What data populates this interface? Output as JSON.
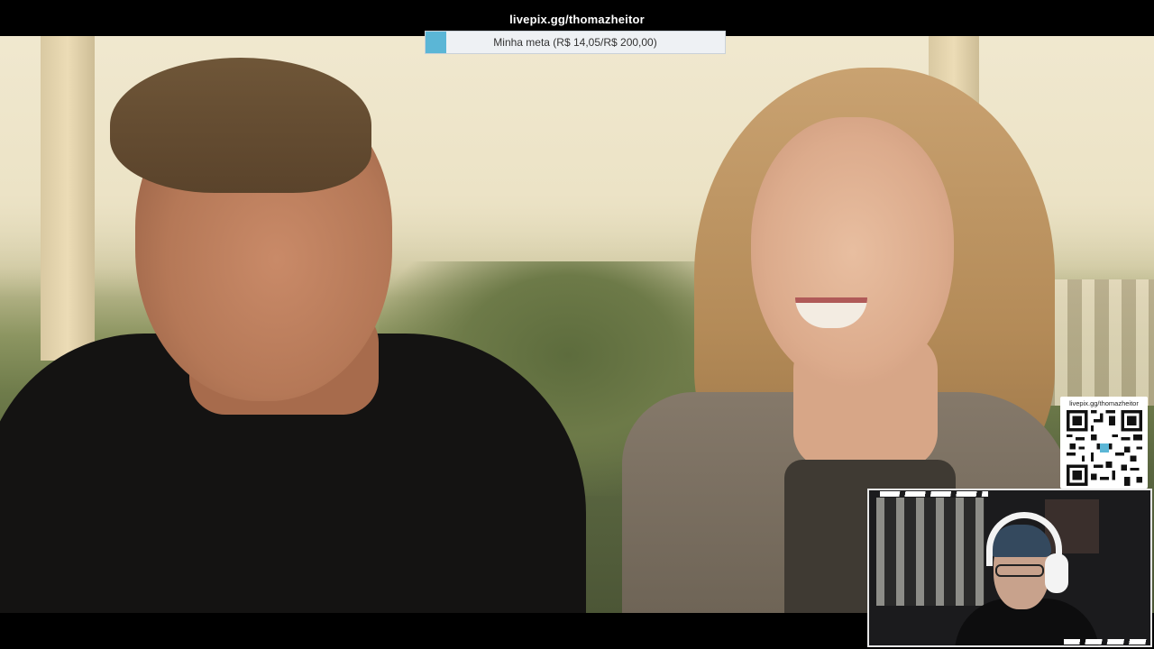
{
  "overlay": {
    "donation_url": "livepix.gg/thomazheitor",
    "goal": {
      "label": "Minha meta (R$ 14,05/R$ 200,00)",
      "current": 14.05,
      "target": 200.0,
      "progress_fraction": 0.07025,
      "fill_color": "#5bb6d6"
    }
  },
  "qr_panel": {
    "caption": "livepix.gg/thomazheitor",
    "icon": "qr-code-icon",
    "center_color": "#5bb6d6"
  },
  "video": {
    "scene": "video-frame"
  },
  "webcam": {
    "accent": "#e7e7e7"
  }
}
